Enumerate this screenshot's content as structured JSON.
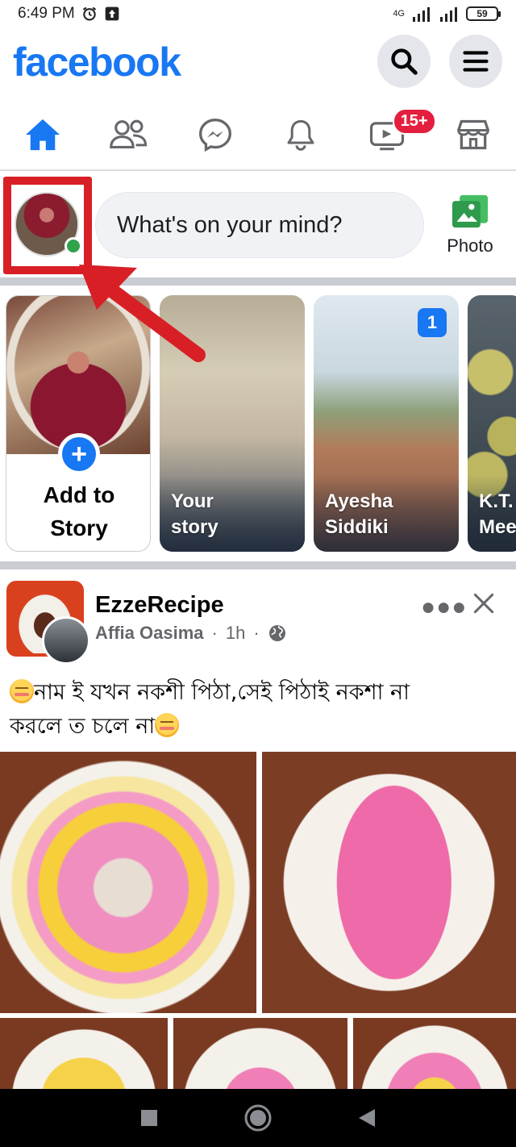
{
  "status_bar": {
    "time": "6:49 PM",
    "network_type": "4G",
    "battery": "59"
  },
  "header": {
    "logo": "facebook",
    "brand_color": "#1877f2"
  },
  "nav": {
    "tabs": [
      {
        "name": "home",
        "icon": "home-icon",
        "active": true
      },
      {
        "name": "friends",
        "icon": "friends-icon"
      },
      {
        "name": "messenger",
        "icon": "messenger-icon"
      },
      {
        "name": "notifications",
        "icon": "bell-icon"
      },
      {
        "name": "watch",
        "icon": "video-icon",
        "badge": "15+"
      },
      {
        "name": "marketplace",
        "icon": "marketplace-icon"
      }
    ]
  },
  "composer": {
    "placeholder": "What's on your mind?",
    "photo_label": "Photo"
  },
  "stories": {
    "add": {
      "label_line1": "Add to",
      "label_line2": "Story"
    },
    "items": [
      {
        "line1": "Your",
        "line2": "story"
      },
      {
        "line1": "Ayesha",
        "line2": "Siddiki",
        "count": "1"
      },
      {
        "line1": "K.T.",
        "line2": "Mee"
      }
    ]
  },
  "post": {
    "page_name": "EzzeRecipe",
    "author": "Affia Oasima",
    "time": "1h",
    "text_line1": "নাম ই যখন নকশী পিঠা,সেই পিঠাই নকশা না",
    "text_line2": "করলে ত চলে না"
  },
  "colors": {
    "highlight_red": "#d81f26",
    "badge_red": "#e41e3f",
    "online_green": "#31a24c"
  }
}
